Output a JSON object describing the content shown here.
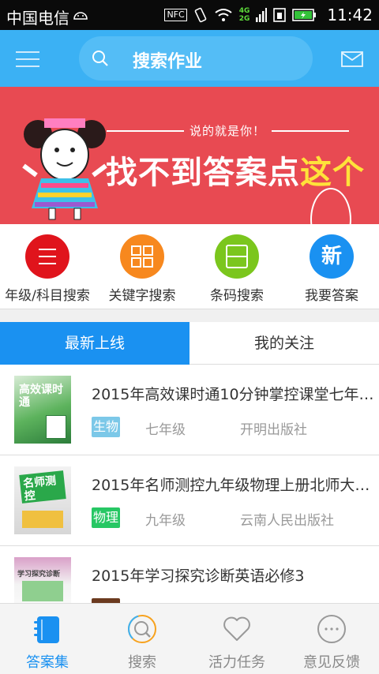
{
  "status_bar": {
    "carrier": "中国电信",
    "nfc": "NFC",
    "net_4g": "4G",
    "net_2g": "2G",
    "time": "11:42"
  },
  "header": {
    "search_label": "搜索作业"
  },
  "banner": {
    "subtitle": "说的就是你！",
    "title_main": "找不到答案点",
    "title_highlight": "这个"
  },
  "quick_nav": [
    {
      "label": "年级/科目搜索",
      "icon": "list-icon",
      "color": "#e0141c"
    },
    {
      "label": "关键字搜索",
      "icon": "grid-icon",
      "color": "#f7881e"
    },
    {
      "label": "条码搜索",
      "icon": "barcode-scan-icon",
      "color": "#7bc61d"
    },
    {
      "label": "我要答案",
      "icon": "new-icon",
      "glyph": "新",
      "color": "#1a91f1"
    }
  ],
  "tabs": [
    {
      "label": "最新上线",
      "active": true
    },
    {
      "label": "我的关注",
      "active": false
    }
  ],
  "books": [
    {
      "title": "2015年高效课时通10分钟掌控课堂七年级生物…",
      "subject": "生物",
      "subject_color": "#7cc8e8",
      "grade": "七年级",
      "publisher": "开明出版社",
      "cover_text": "高效课时通"
    },
    {
      "title": "2015年名师测控九年级物理上册北师大版…",
      "subject": "物理",
      "subject_color": "#27c764",
      "grade": "九年级",
      "publisher": "云南人民出版社",
      "cover_text": "名师测控"
    },
    {
      "title": "2015年学习探究诊断英语必修3",
      "subject": "",
      "subject_color": "#6b3a1f",
      "grade": "",
      "publisher": "",
      "cover_text": "学习探究诊断"
    }
  ],
  "bottom_nav": [
    {
      "label": "答案集",
      "icon": "notebook-icon",
      "active": true
    },
    {
      "label": "搜索",
      "icon": "search-icon",
      "active": false
    },
    {
      "label": "活力任务",
      "icon": "heart-icon",
      "active": false
    },
    {
      "label": "意见反馈",
      "icon": "feedback-icon",
      "active": false
    }
  ],
  "colors": {
    "primary": "#3bb1f4",
    "accent": "#1a91f1",
    "banner": "#e84a52"
  }
}
